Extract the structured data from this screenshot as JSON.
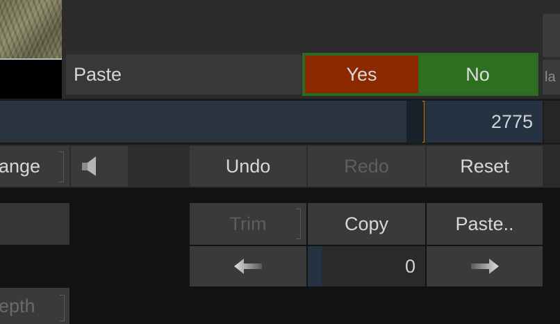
{
  "paste_confirm": {
    "label": "Paste",
    "yes": "Yes",
    "no": "No",
    "side_tab": "la"
  },
  "timeline": {
    "frame_value": "2775"
  },
  "toolbar": {
    "range_label": "ange",
    "speaker_icon": "speaker-icon",
    "undo": "Undo",
    "redo": "Redo",
    "reset": "Reset"
  },
  "edit": {
    "trim": "Trim",
    "copy": "Copy",
    "paste": "Paste..",
    "offset_value": "0",
    "left_arrow_icon": "arrow-left-icon",
    "right_arrow_icon": "arrow-right-icon"
  },
  "lower": {
    "depth_label": "epth"
  },
  "colors": {
    "yes": "#8b2a00",
    "no": "#2e6f22",
    "accent": "#d08a1a",
    "field": "#243242"
  }
}
